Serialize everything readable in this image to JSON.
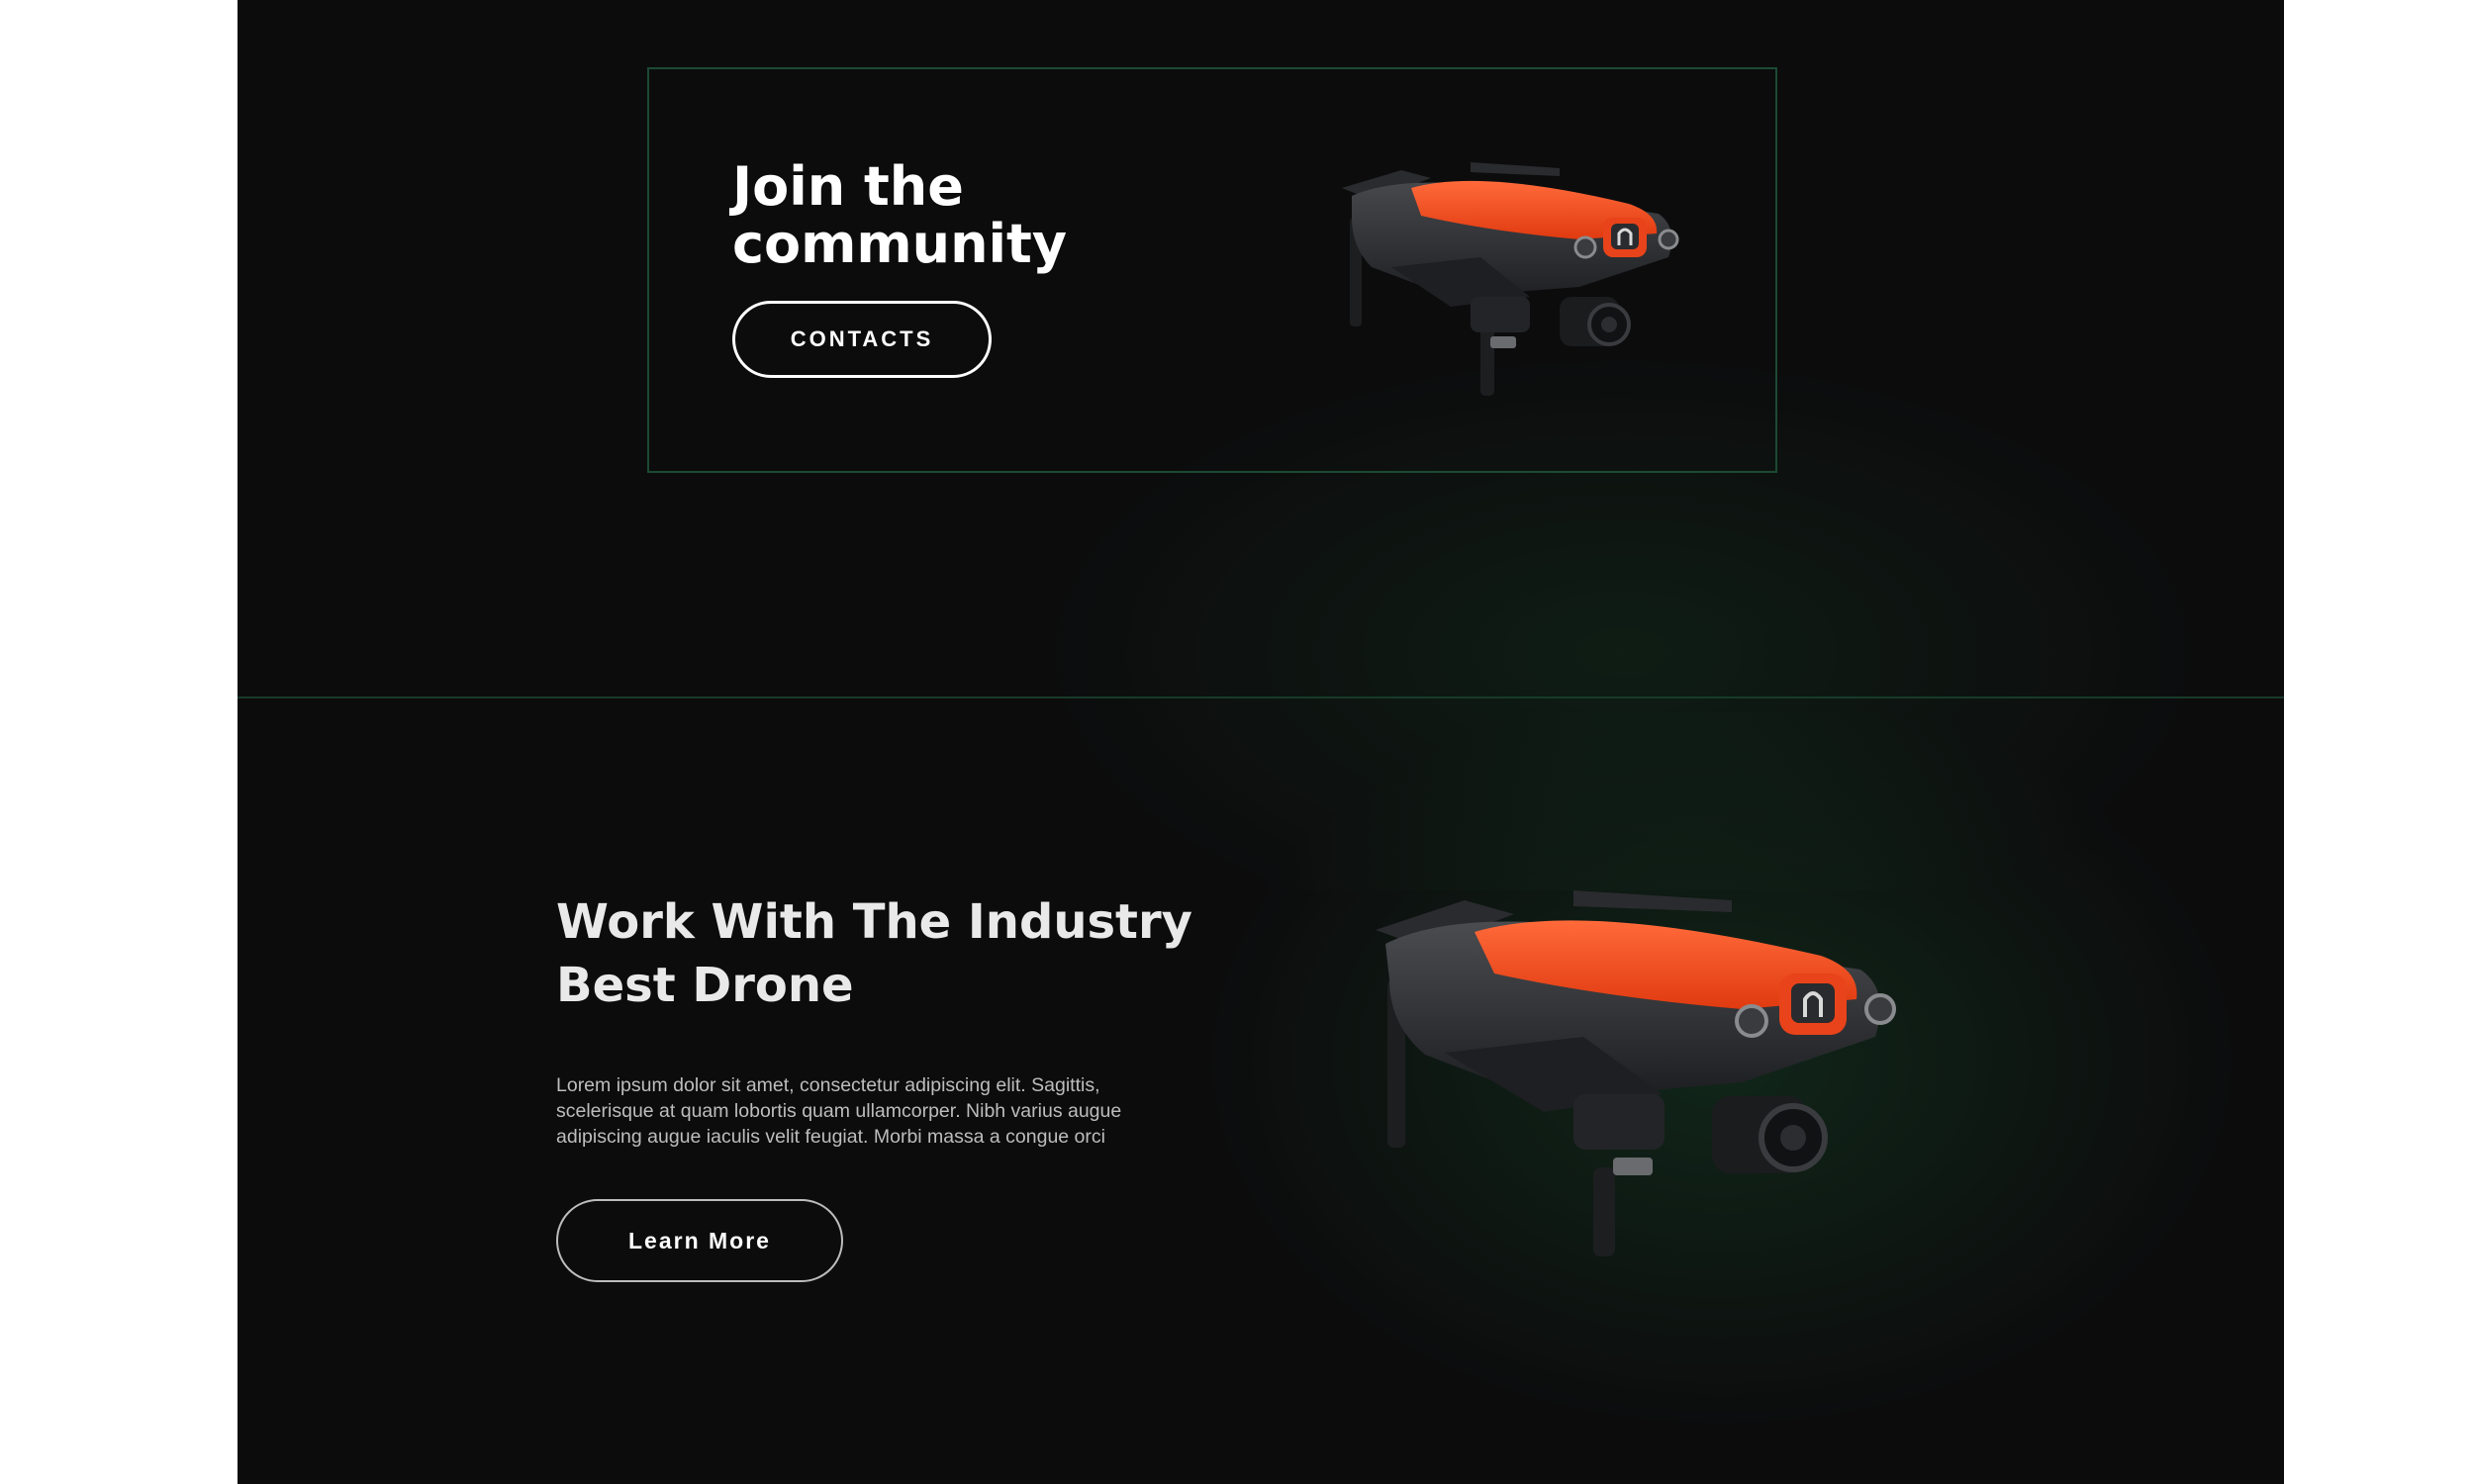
{
  "community": {
    "title": "Join the community",
    "button_label": "CONTACTS"
  },
  "industry": {
    "title": "Work With The Industry Best Drone",
    "body": "Lorem ipsum dolor sit amet, consectetur adipiscing elit. Sagittis, scelerisque at quam lobortis quam ullamcorper. Nibh varius augue adipiscing augue iaculis velit feugiat. Morbi massa a congue orci",
    "button_label": "Learn More"
  },
  "colors": {
    "background": "#0c0c0d",
    "accent_border": "#1c4a33",
    "drone_orange": "#ff4a1c",
    "drone_body": "#2e2f32"
  },
  "images": {
    "drone_small": "orange-drone-image",
    "drone_large": "orange-drone-image"
  }
}
